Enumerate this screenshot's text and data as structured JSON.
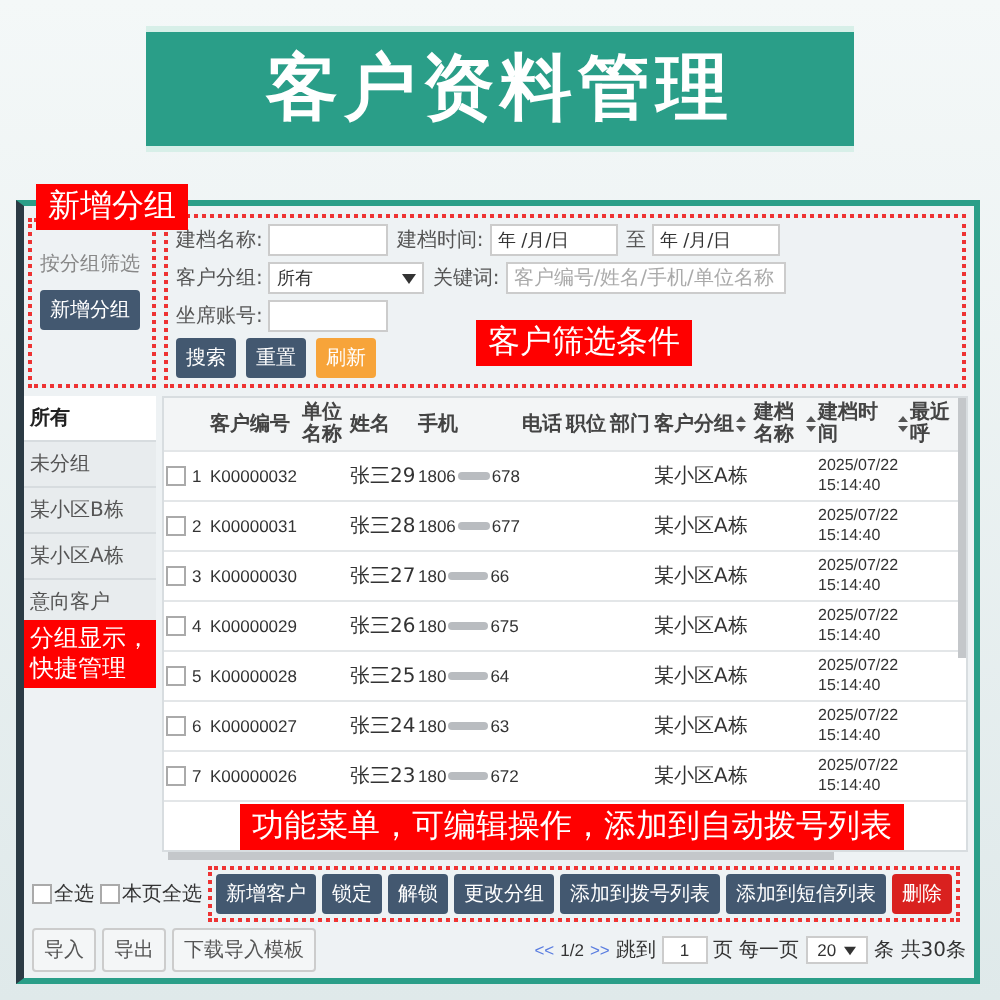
{
  "banner": {
    "title": "客户资料管理"
  },
  "callouts": [
    {
      "text": "新增分组"
    },
    {
      "text": "客户筛选条件"
    },
    {
      "text": "分组显示，快捷管理"
    },
    {
      "text": "功能菜单，可编辑操作，添加到自动拨号列表"
    }
  ],
  "sidebar": {
    "filter_label": "按分组筛选",
    "add_button": "新增分组",
    "groups": [
      {
        "label": "所有",
        "selected": true
      },
      {
        "label": "未分组",
        "selected": false
      },
      {
        "label": "某小区B栋",
        "selected": false
      },
      {
        "label": "某小区A栋",
        "selected": false
      },
      {
        "label": "意向客户",
        "selected": false
      }
    ]
  },
  "filters": {
    "fields": [
      {
        "label": "建档名称:",
        "kind": "text"
      },
      {
        "label": "建档时间:",
        "kind": "date",
        "value": "年 /月/日"
      },
      {
        "label": "至",
        "kind": "date",
        "value": "年 /月/日"
      },
      {
        "label": "客户分组:",
        "kind": "select",
        "value": "所有"
      },
      {
        "label": "关键词:",
        "kind": "text",
        "placeholder": "客户编号/姓名/手机/单位名称"
      },
      {
        "label": "坐席账号:",
        "kind": "text"
      }
    ],
    "buttons": [
      {
        "label": "搜索",
        "kind": "primary"
      },
      {
        "label": "重置",
        "kind": "primary"
      },
      {
        "label": "刷新",
        "kind": "warning"
      }
    ]
  },
  "table": {
    "columns": [
      {
        "label": "客户编号",
        "sortable": false
      },
      {
        "label": "单位名称",
        "sortable": false
      },
      {
        "label": "姓名",
        "sortable": false
      },
      {
        "label": "手机",
        "sortable": false
      },
      {
        "label": "电话",
        "sortable": false
      },
      {
        "label": "职位",
        "sortable": false
      },
      {
        "label": "部门",
        "sortable": false
      },
      {
        "label": "客户分组",
        "sortable": true
      },
      {
        "label": "建档名称",
        "sortable": true
      },
      {
        "label": "建档时间",
        "sortable": true
      },
      {
        "label": "最近呼",
        "sortable": false
      }
    ],
    "rows": [
      {
        "checked": false,
        "index": "1",
        "number": "K00000032",
        "name": "张三29",
        "phone_start": "1806",
        "phone_end": "678",
        "group": "某小区A栋",
        "date": "2025/07/22",
        "time": "15:14:40"
      },
      {
        "checked": false,
        "index": "2",
        "number": "K00000031",
        "name": "张三28",
        "phone_start": "1806",
        "phone_end": "677",
        "group": "某小区A栋",
        "date": "2025/07/22",
        "time": "15:14:40"
      },
      {
        "checked": false,
        "index": "3",
        "number": "K00000030",
        "name": "张三27",
        "phone_start": "180",
        "phone_end": "66",
        "group": "某小区A栋",
        "date": "2025/07/22",
        "time": "15:14:40"
      },
      {
        "checked": false,
        "index": "4",
        "number": "K00000029",
        "name": "张三26",
        "phone_start": "180",
        "phone_end": "675",
        "group": "某小区A栋",
        "date": "2025/07/22",
        "time": "15:14:40"
      },
      {
        "checked": false,
        "index": "5",
        "number": "K00000028",
        "name": "张三25",
        "phone_start": "180",
        "phone_end": "64",
        "group": "某小区A栋",
        "date": "2025/07/22",
        "time": "15:14:40"
      },
      {
        "checked": false,
        "index": "6",
        "number": "K00000027",
        "name": "张三24",
        "phone_start": "180",
        "phone_end": "63",
        "group": "某小区A栋",
        "date": "2025/07/22",
        "time": "15:14:40"
      },
      {
        "checked": false,
        "index": "7",
        "number": "K00000026",
        "name": "张三23",
        "phone_start": "180",
        "phone_end": "672",
        "group": "某小区A栋",
        "date": "2025/07/22",
        "time": "15:14:40"
      }
    ]
  },
  "footer": {
    "select_all": {
      "label": "全选",
      "checked": false
    },
    "select_page": {
      "label": "本页全选",
      "checked": false
    },
    "actions": [
      {
        "label": "新增客户",
        "kind": "primary"
      },
      {
        "label": "锁定",
        "kind": "primary"
      },
      {
        "label": "解锁",
        "kind": "primary"
      },
      {
        "label": "更改分组",
        "kind": "primary"
      },
      {
        "label": "添加到拨号列表",
        "kind": "primary"
      },
      {
        "label": "添加到短信列表",
        "kind": "primary"
      },
      {
        "label": "删除",
        "kind": "danger"
      }
    ],
    "secondary": [
      "导入",
      "导出",
      "下载导入模板"
    ],
    "pagination": {
      "prev": "<<",
      "page": "1/2",
      "next": ">>",
      "goto_label": "跳到",
      "goto_value": "1",
      "goto_unit": "页",
      "per_page_label": "每一页",
      "per_page": "20",
      "total": "条 共30条"
    }
  }
}
